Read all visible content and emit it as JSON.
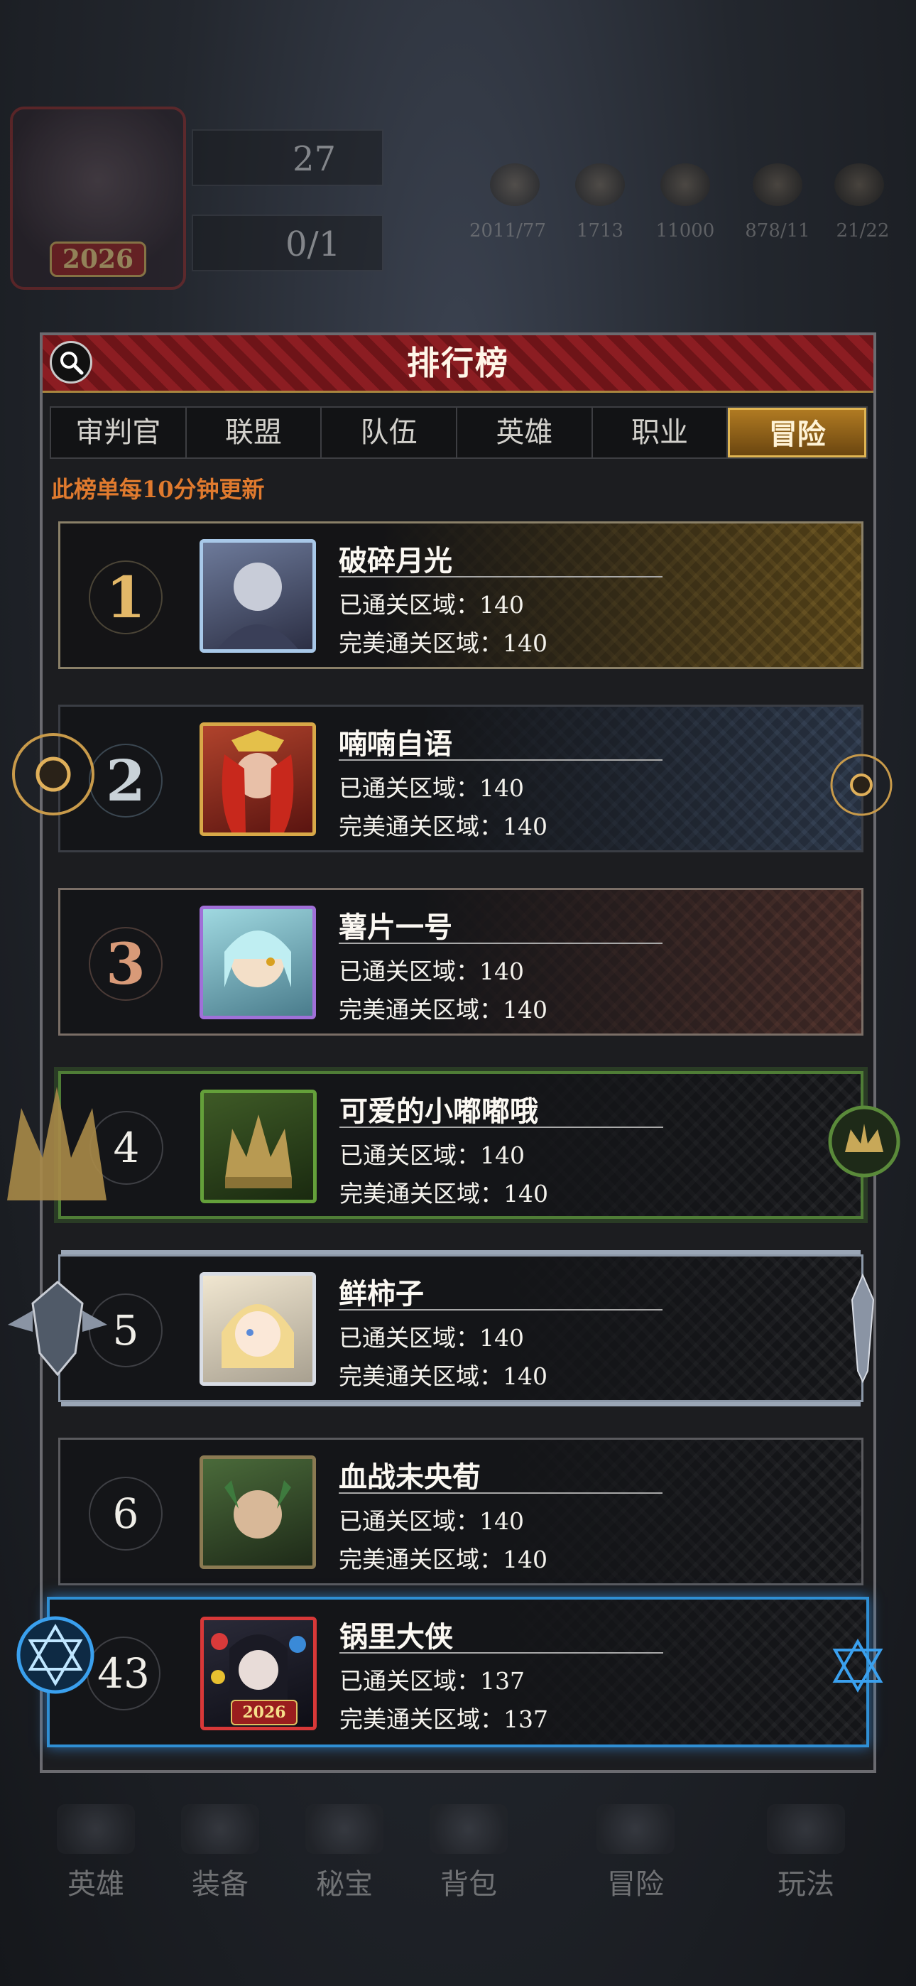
{
  "background": {
    "player_avatar_year": "2026",
    "stat_1": "27",
    "stat_2": "0/1",
    "resource_labels": [
      "2011/77",
      "1713",
      "11000",
      "878/11",
      "21/22"
    ],
    "nav": [
      "英雄",
      "装备",
      "秘宝",
      "背包",
      "冒险",
      "玩法"
    ]
  },
  "panel": {
    "title": "排行榜",
    "tabs": [
      "审判官",
      "联盟",
      "队伍",
      "英雄",
      "职业",
      "冒险"
    ],
    "active_tab": "冒险",
    "notice": "此榜单每10分钟更新"
  },
  "stat_labels": {
    "cleared": "已通关区域：",
    "perfect": "完美通关区域："
  },
  "rows": [
    {
      "rank": "1",
      "name": "破碎月光",
      "cleared": "140",
      "perfect": "140"
    },
    {
      "rank": "2",
      "name": "喃喃自语",
      "cleared": "140",
      "perfect": "140"
    },
    {
      "rank": "3",
      "name": "薯片一号",
      "cleared": "140",
      "perfect": "140"
    },
    {
      "rank": "4",
      "name": "可爱的小嘟嘟哦",
      "cleared": "140",
      "perfect": "140"
    },
    {
      "rank": "5",
      "name": "鲜柿子",
      "cleared": "140",
      "perfect": "140"
    },
    {
      "rank": "6",
      "name": "血战未央荀",
      "cleared": "140",
      "perfect": "140"
    }
  ],
  "self_row": {
    "rank": "43",
    "name": "锅里大侠",
    "cleared": "137",
    "perfect": "137",
    "avatar_year": "2026"
  },
  "colors": {
    "accent_gold": "#e0b552",
    "notice_orange": "#e07a2e",
    "title_red": "#8c1d22",
    "self_blue": "#2f8fd4"
  }
}
